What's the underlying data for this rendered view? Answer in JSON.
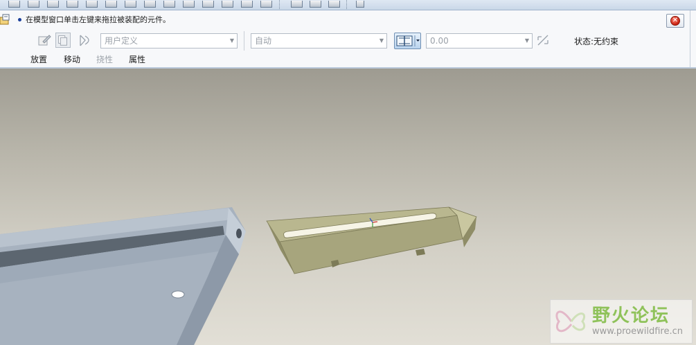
{
  "prompt": {
    "text": "在模型窗口单击左键来拖拉被装配的元件。"
  },
  "dashboard": {
    "constraint_set_combo": {
      "value": "用户定义"
    },
    "constraint_type_combo": {
      "value": "自动"
    },
    "offset_combo": {
      "value": "0.00"
    },
    "status": "状态:无约束",
    "tabs": [
      {
        "label": "放置",
        "enabled": true
      },
      {
        "label": "移动",
        "enabled": true
      },
      {
        "label": "挠性",
        "enabled": false
      },
      {
        "label": "属性",
        "enabled": true
      }
    ]
  },
  "watermark": {
    "title": "野火论坛",
    "url": "www.proewildfire.cn"
  },
  "colors": {
    "accent": "#7fa8d6",
    "part_gray": "#9aa8b8",
    "bracket_olive": "#b9b78f"
  }
}
